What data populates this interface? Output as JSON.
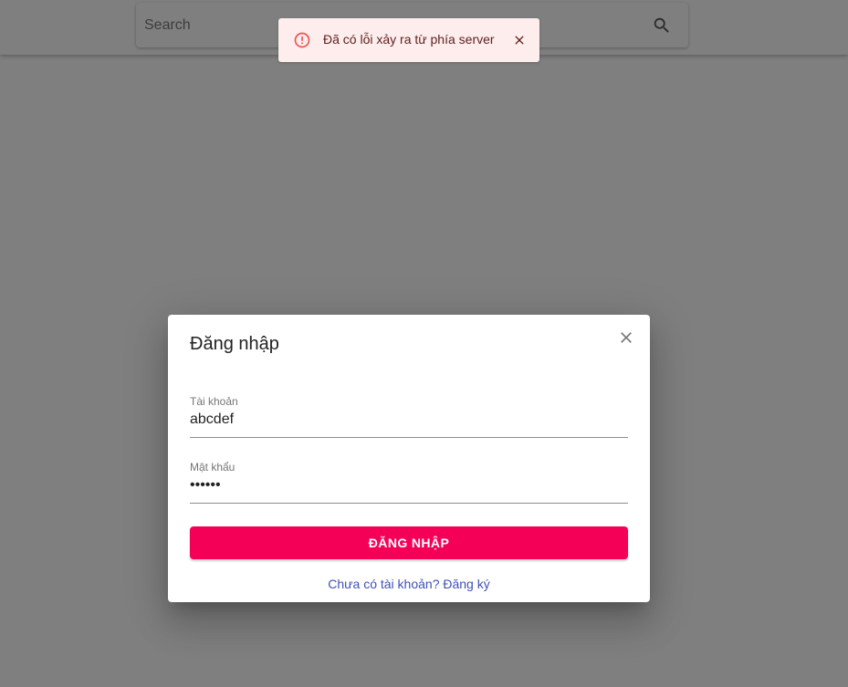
{
  "search": {
    "placeholder": "Search",
    "icon": "search-icon"
  },
  "toast": {
    "severity": "error",
    "message": "Đã có lỗi xảy ra từ phía server",
    "icon": "error-outline-icon",
    "close_icon": "close-icon",
    "color": "#f44336"
  },
  "dialog": {
    "title": "Đăng nhập",
    "close_icon": "close-icon",
    "username": {
      "label": "Tài khoản",
      "value": "abcdef"
    },
    "password": {
      "label": "Mật khẩu",
      "value": "abcdef"
    },
    "submit_label": "ĐĂNG NHẬP",
    "register_link": "Chưa có tài khoản? Đăng ký"
  },
  "colors": {
    "primary": "#f50057",
    "link": "#3f51b5",
    "error_bg": "#fdeded"
  }
}
